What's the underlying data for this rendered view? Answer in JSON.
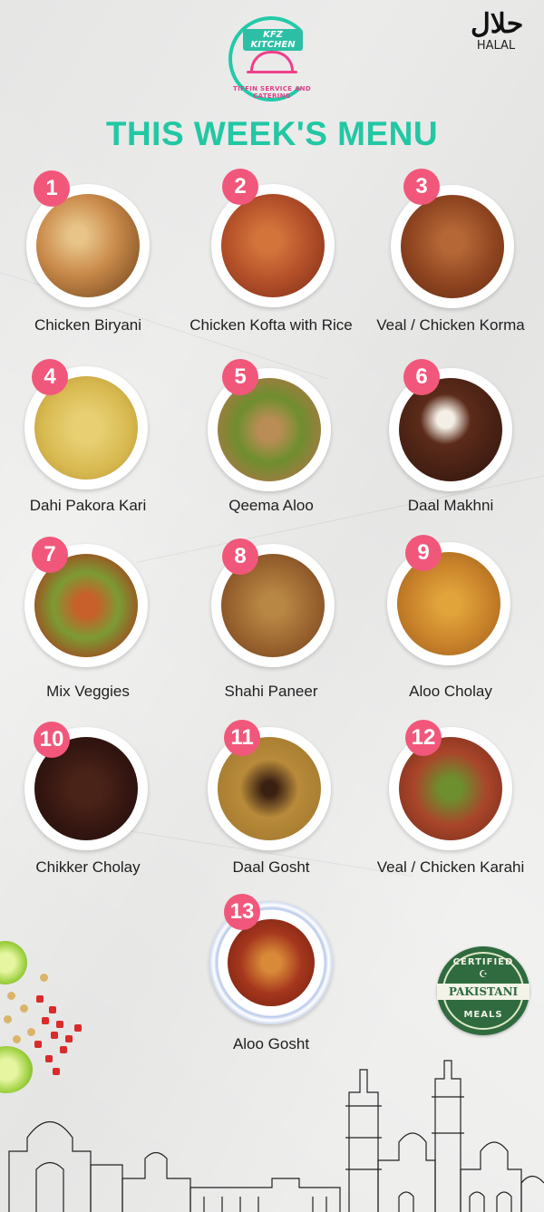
{
  "logo": {
    "brand": "KFZ KITCHEN",
    "tagline": "TIFFIN SERVICE AND CATERING"
  },
  "halal": {
    "glyph": "حلال",
    "label": "HALAL"
  },
  "title": "THIS WEEK'S MENU",
  "colors": {
    "accent": "#22c7a4",
    "badge": "#f1577a"
  },
  "menu": [
    {
      "number": "1",
      "name": "Chicken Biryani"
    },
    {
      "number": "2",
      "name": "Chicken Kofta with Rice"
    },
    {
      "number": "3",
      "name": "Veal / Chicken Korma"
    },
    {
      "number": "4",
      "name": "Dahi Pakora Kari"
    },
    {
      "number": "5",
      "name": "Qeema Aloo"
    },
    {
      "number": "6",
      "name": "Daal Makhni"
    },
    {
      "number": "7",
      "name": "Mix Veggies"
    },
    {
      "number": "8",
      "name": "Shahi Paneer"
    },
    {
      "number": "9",
      "name": "Aloo Cholay"
    },
    {
      "number": "10",
      "name": "Chikker Cholay"
    },
    {
      "number": "11",
      "name": "Daal Gosht"
    },
    {
      "number": "12",
      "name": "Veal / Chicken Karahi"
    },
    {
      "number": "13",
      "name": "Aloo Gosht"
    }
  ],
  "certified": {
    "top": "CERTIFIED",
    "middle": "PAKISTANI",
    "bottom": "MEALS"
  }
}
